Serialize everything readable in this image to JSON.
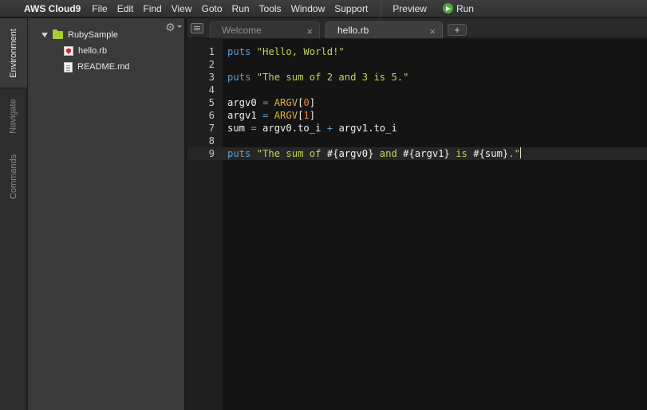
{
  "menubar": {
    "brand": "AWS Cloud9",
    "items": [
      "File",
      "Edit",
      "Find",
      "View",
      "Goto",
      "Run",
      "Tools",
      "Window",
      "Support"
    ],
    "preview": "Preview",
    "run": "Run"
  },
  "sidetabs": [
    "Environment",
    "Navigate",
    "Commands"
  ],
  "filetree": {
    "root": "RubySample",
    "files": [
      "hello.rb",
      "README.md"
    ]
  },
  "tabs": [
    {
      "label": "Welcome",
      "close": "×"
    },
    {
      "label": "hello.rb",
      "close": "×"
    }
  ],
  "add_tab": "+",
  "editor": {
    "lines": [
      {
        "n": "1",
        "tokens": [
          [
            "kw",
            "puts"
          ],
          [
            "id",
            " "
          ],
          [
            "str",
            "\"Hello, World!\""
          ]
        ]
      },
      {
        "n": "2",
        "tokens": []
      },
      {
        "n": "3",
        "tokens": [
          [
            "kw",
            "puts"
          ],
          [
            "id",
            " "
          ],
          [
            "str",
            "\"The sum of 2 and 3 is 5.\""
          ]
        ]
      },
      {
        "n": "4",
        "tokens": []
      },
      {
        "n": "5",
        "tokens": [
          [
            "id",
            "argv0 "
          ],
          [
            "op",
            "="
          ],
          [
            "id",
            " "
          ],
          [
            "const",
            "ARGV"
          ],
          [
            "id",
            "["
          ],
          [
            "num",
            "0"
          ],
          [
            "id",
            "]"
          ]
        ]
      },
      {
        "n": "6",
        "tokens": [
          [
            "id",
            "argv1 "
          ],
          [
            "op",
            "="
          ],
          [
            "id",
            " "
          ],
          [
            "const",
            "ARGV"
          ],
          [
            "id",
            "["
          ],
          [
            "num",
            "1"
          ],
          [
            "id",
            "]"
          ]
        ]
      },
      {
        "n": "7",
        "tokens": [
          [
            "id",
            "sum "
          ],
          [
            "op",
            "="
          ],
          [
            "id",
            " argv0.to_i "
          ],
          [
            "op",
            "+"
          ],
          [
            "id",
            " argv1.to_i"
          ]
        ]
      },
      {
        "n": "8",
        "tokens": []
      },
      {
        "n": "9",
        "tokens": [
          [
            "kw",
            "puts"
          ],
          [
            "id",
            " "
          ],
          [
            "str",
            "\"The sum of "
          ],
          [
            "id",
            "#{argv0}"
          ],
          [
            "str",
            " and "
          ],
          [
            "id",
            "#{argv1}"
          ],
          [
            "str",
            " is "
          ],
          [
            "id",
            "#{sum}"
          ],
          [
            "str",
            ".\""
          ]
        ],
        "current": true
      }
    ]
  }
}
